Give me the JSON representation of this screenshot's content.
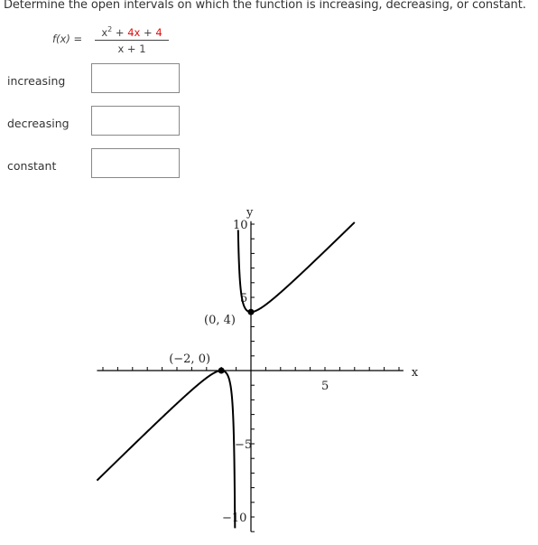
{
  "question": {
    "prompt": "Determine the open intervals on which the function is increasing, decreasing, or constant.",
    "function_lhs": "f(x) =",
    "numerator": {
      "x2": "x",
      "sup": "2",
      "plus1": " + ",
      "coef": "4",
      "xvar": "x",
      "plus2": " + ",
      "const": "4"
    },
    "denominator": "x + 1"
  },
  "answers": [
    {
      "label": "increasing",
      "value": ""
    },
    {
      "label": "decreasing",
      "value": ""
    },
    {
      "label": "constant",
      "value": ""
    }
  ],
  "chart_data": {
    "type": "line",
    "function": "(x^2 + 4x + 4)/(x + 1)",
    "xlabel": "x",
    "ylabel": "y",
    "xlim": [
      -10.4,
      10.3
    ],
    "ylim": [
      -11,
      10.2
    ],
    "x_tick_labels": [
      "5"
    ],
    "y_tick_labels": [
      "10",
      "5",
      "-5",
      "-10"
    ],
    "points": [
      {
        "label": "(0, 4)",
        "x": 0,
        "y": 4
      },
      {
        "label": "(−2, 0)",
        "x": -2,
        "y": 0
      }
    ],
    "asymptote_x": -1,
    "grid": false
  }
}
